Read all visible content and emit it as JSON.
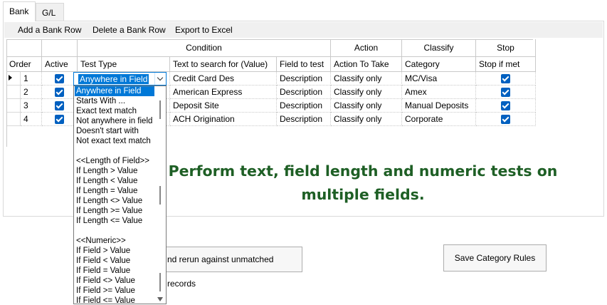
{
  "tabs": [
    {
      "label": "Bank",
      "active": true
    },
    {
      "label": "G/L",
      "active": false
    }
  ],
  "menu": {
    "add_row": "Add a Bank Row",
    "delete_row": "Delete a Bank Row",
    "export": "Export to Excel"
  },
  "grid": {
    "group_headers": {
      "condition": "Condition",
      "action": "Action",
      "classify": "Classify",
      "stop": "Stop"
    },
    "columns": {
      "order": "Order",
      "active": "Active",
      "test_type": "Test Type",
      "search_text": "Text to search for (Value)",
      "field": "Field to test",
      "action": "Action To Take",
      "category": "Category",
      "stop": "Stop if met"
    },
    "rows": [
      {
        "order": "1",
        "active": true,
        "test_type": "Anywhere in Field",
        "search_text": "Credit Card Des",
        "field": "Description",
        "action": "Classify only",
        "category": "MC/Visa",
        "stop": true
      },
      {
        "order": "2",
        "active": true,
        "test_type": "",
        "search_text": "American Express",
        "field": "Description",
        "action": "Classify only",
        "category": "Amex",
        "stop": true
      },
      {
        "order": "3",
        "active": true,
        "test_type": "",
        "search_text": "Deposit Site",
        "field": "Description",
        "action": "Classify only",
        "category": "Manual Deposits",
        "stop": true
      },
      {
        "order": "4",
        "active": true,
        "test_type": "",
        "search_text": "ACH Origination",
        "field": "Description",
        "action": "Classify only",
        "category": "Corporate",
        "stop": true
      }
    ]
  },
  "dropdown": {
    "selected": "Anywhere in Field",
    "options": [
      "Anywhere in Field",
      "Starts With ...",
      "Exact text match",
      "Not anywhere in field",
      "Doesn't start with",
      "Not exact text match",
      "",
      "<<Length of Field>>",
      "If Length > Value",
      "If Length < Value",
      "If Length = Value",
      "If Length <> Value",
      "If Length >= Value",
      "If Length <= Value",
      "",
      "<<Numeric>>",
      "If Field > Value",
      "If Field < Value",
      "If Field = Value",
      "If Field <> Value",
      "If Field >= Value",
      "If Field <= Value"
    ]
  },
  "promo": {
    "line1": "Perform text, field length and numeric tests on",
    "line2": "multiple fields."
  },
  "buttons": {
    "rerun": "nd rerun against unmatched records",
    "save": "Save Category Rules"
  },
  "colors": {
    "accent": "#0078d7",
    "checkbox": "#0060c0",
    "promo_text": "#1e5f25"
  }
}
